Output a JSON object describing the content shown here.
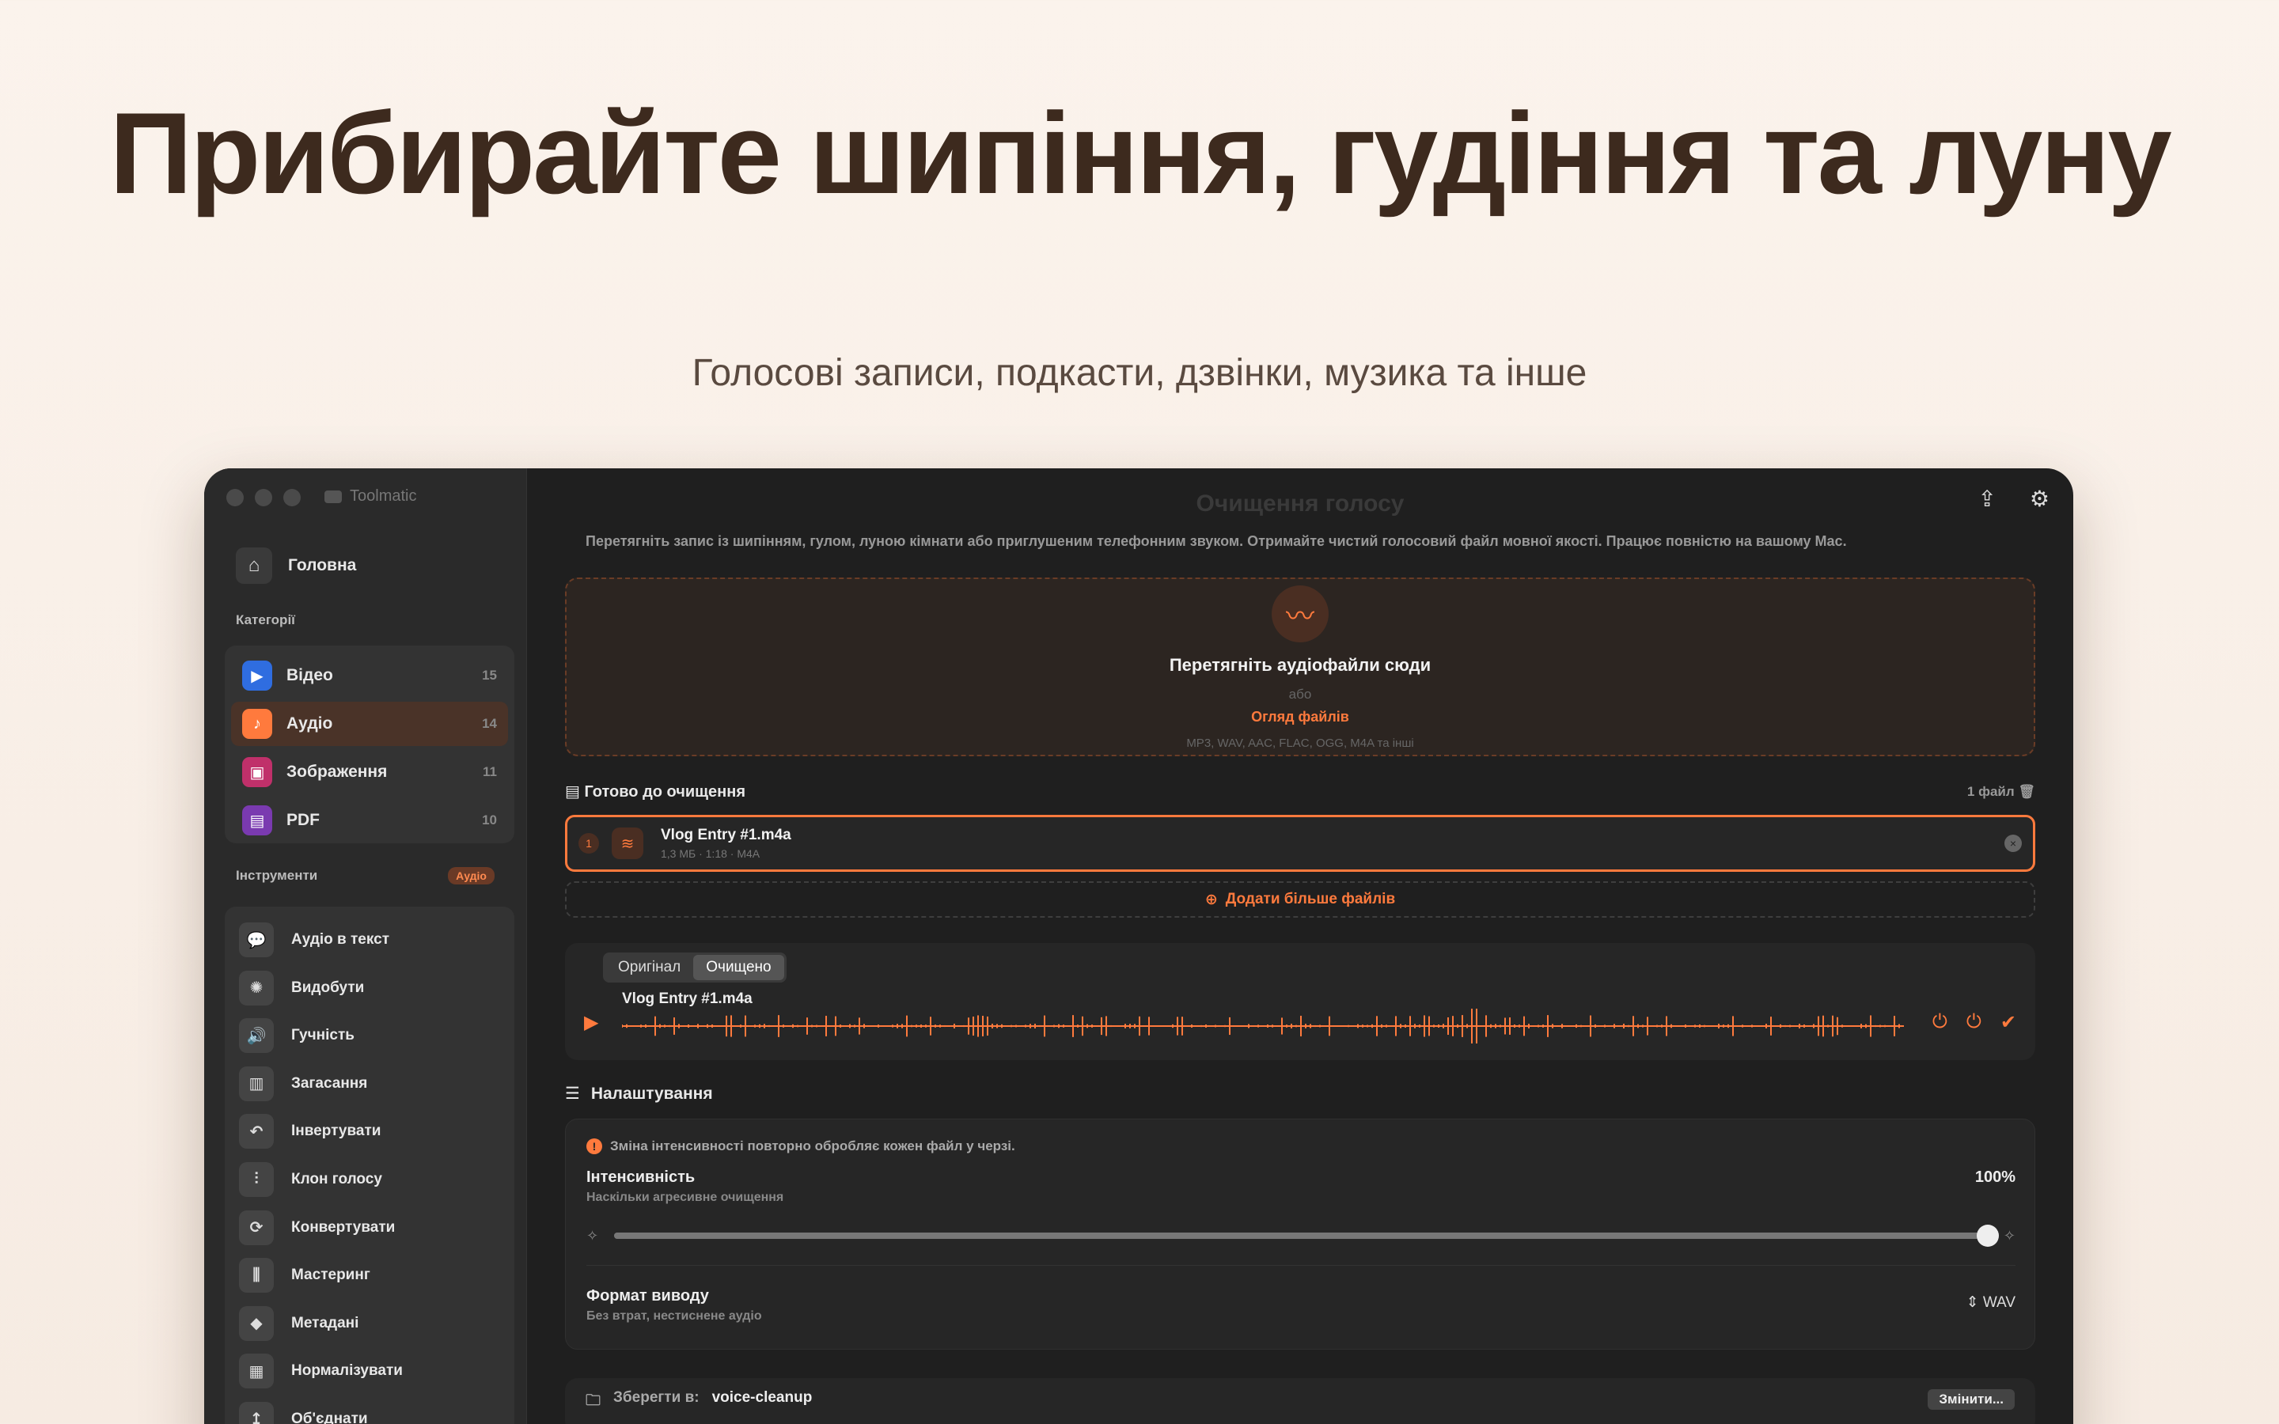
{
  "hero": {
    "title": "Прибирайте шипіння, гудіння та луну",
    "subtitle": "Голосові записи, подкасти, дзвінки, музика та інше"
  },
  "app": {
    "name": "Toolmatic",
    "title": "Очищення голосу"
  },
  "sidebar": {
    "home": "Головна",
    "categories_label": "Категорії",
    "categories": [
      {
        "label": "Відео",
        "count": "15",
        "icon": "video-icon",
        "color": "#2f6de0"
      },
      {
        "label": "Аудіо",
        "count": "14",
        "icon": "music-note-icon",
        "color": "#ff7a3d",
        "active": true
      },
      {
        "label": "Зображення",
        "count": "11",
        "icon": "image-icon",
        "color": "#c0306a"
      },
      {
        "label": "PDF",
        "count": "10",
        "icon": "document-icon",
        "color": "#7a3ab0"
      }
    ],
    "tools_label": "Інструменти",
    "tools_badge": "Аудіо",
    "tools": [
      {
        "label": "Аудіо в текст",
        "icon": "speech-bubble-icon"
      },
      {
        "label": "Видобути",
        "icon": "waveform-icon"
      },
      {
        "label": "Гучність",
        "icon": "speaker-icon"
      },
      {
        "label": "Загасання",
        "icon": "fade-icon"
      },
      {
        "label": "Інвертувати",
        "icon": "undo-icon"
      },
      {
        "label": "Клон голосу",
        "icon": "voice-clone-icon"
      },
      {
        "label": "Конвертувати",
        "icon": "convert-icon"
      },
      {
        "label": "Мастеринг",
        "icon": "mastering-icon"
      },
      {
        "label": "Метадані",
        "icon": "tag-icon"
      },
      {
        "label": "Нормалізувати",
        "icon": "normalize-icon"
      },
      {
        "label": "Об'єднати",
        "icon": "merge-icon"
      }
    ]
  },
  "main": {
    "description": "Перетягніть запис із шипінням, гулом, луною кімнати або приглушеним телефонним звуком. Отримайте чистий голосовий файл мовної якості. Працює повністю на вашому Mac.",
    "drop": {
      "title": "Перетягніть аудіофайли сюди",
      "or": "або",
      "browse": "Огляд файлів",
      "formats": "MP3, WAV, AAC, FLAC, OGG, M4A та інші"
    },
    "ready_label": "Готово до очищення",
    "file_count": "1 файл",
    "file": {
      "index": "1",
      "name": "Vlog Entry #1.m4a",
      "meta": "1,3 МБ · 1:18 · M4A"
    },
    "add_more": "Додати більше файлів",
    "player": {
      "tab_original": "Оригінал",
      "tab_cleaned": "Очищено",
      "file_name": "Vlog Entry #1.m4a"
    },
    "settings_label": "Налаштування",
    "warning": "Зміна інтенсивності повторно обробляє кожен файл у черзі.",
    "intensity_label": "Інтенсивність",
    "intensity_sub": "Наскільки агресивне очищення",
    "intensity_value": "100%",
    "intensity_fraction": 1.0,
    "format_label": "Формат виводу",
    "format_sub": "Без втрат, нестиснене аудіо",
    "format_value": "WAV",
    "save_label": "Зберегти в:",
    "save_folder": "voice-cleanup",
    "change_button": "Змінити..."
  },
  "colors": {
    "accent": "#ff7a3d",
    "hero_text": "#3d2a1e"
  }
}
